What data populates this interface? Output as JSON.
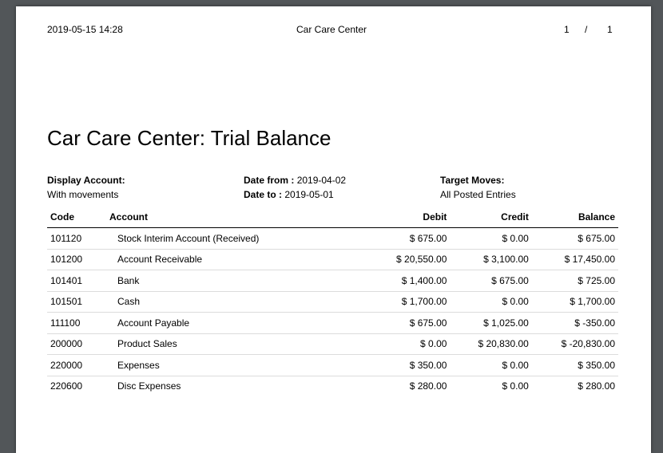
{
  "header": {
    "datetime": "2019-05-15 14:28",
    "company": "Car Care Center",
    "page_current": "1",
    "page_separator": "/",
    "page_total": "1"
  },
  "report": {
    "title": "Car Care Center: Trial Balance",
    "display_account_label": "Display Account:",
    "display_account_value": "With movements",
    "date_from_label": "Date from :",
    "date_from_value": "2019-04-02",
    "date_to_label": "Date to :",
    "date_to_value": "2019-05-01",
    "target_moves_label": "Target Moves:",
    "target_moves_value": "All Posted Entries"
  },
  "table": {
    "columns": [
      "Code",
      "Account",
      "Debit",
      "Credit",
      "Balance"
    ],
    "rows": [
      {
        "code": "101120",
        "account": "Stock Interim Account (Received)",
        "debit": "$ 675.00",
        "credit": "$ 0.00",
        "balance": "$ 675.00"
      },
      {
        "code": "101200",
        "account": "Account Receivable",
        "debit": "$ 20,550.00",
        "credit": "$ 3,100.00",
        "balance": "$ 17,450.00"
      },
      {
        "code": "101401",
        "account": "Bank",
        "debit": "$ 1,400.00",
        "credit": "$ 675.00",
        "balance": "$ 725.00"
      },
      {
        "code": "101501",
        "account": "Cash",
        "debit": "$ 1,700.00",
        "credit": "$ 0.00",
        "balance": "$ 1,700.00"
      },
      {
        "code": "111100",
        "account": "Account Payable",
        "debit": "$ 675.00",
        "credit": "$ 1,025.00",
        "balance": "$ -350.00"
      },
      {
        "code": "200000",
        "account": "Product Sales",
        "debit": "$ 0.00",
        "credit": "$ 20,830.00",
        "balance": "$ -20,830.00"
      },
      {
        "code": "220000",
        "account": "Expenses",
        "debit": "$ 350.00",
        "credit": "$ 0.00",
        "balance": "$ 350.00"
      },
      {
        "code": "220600",
        "account": "Disc Expenses",
        "debit": "$ 280.00",
        "credit": "$ 0.00",
        "balance": "$ 280.00"
      }
    ]
  }
}
